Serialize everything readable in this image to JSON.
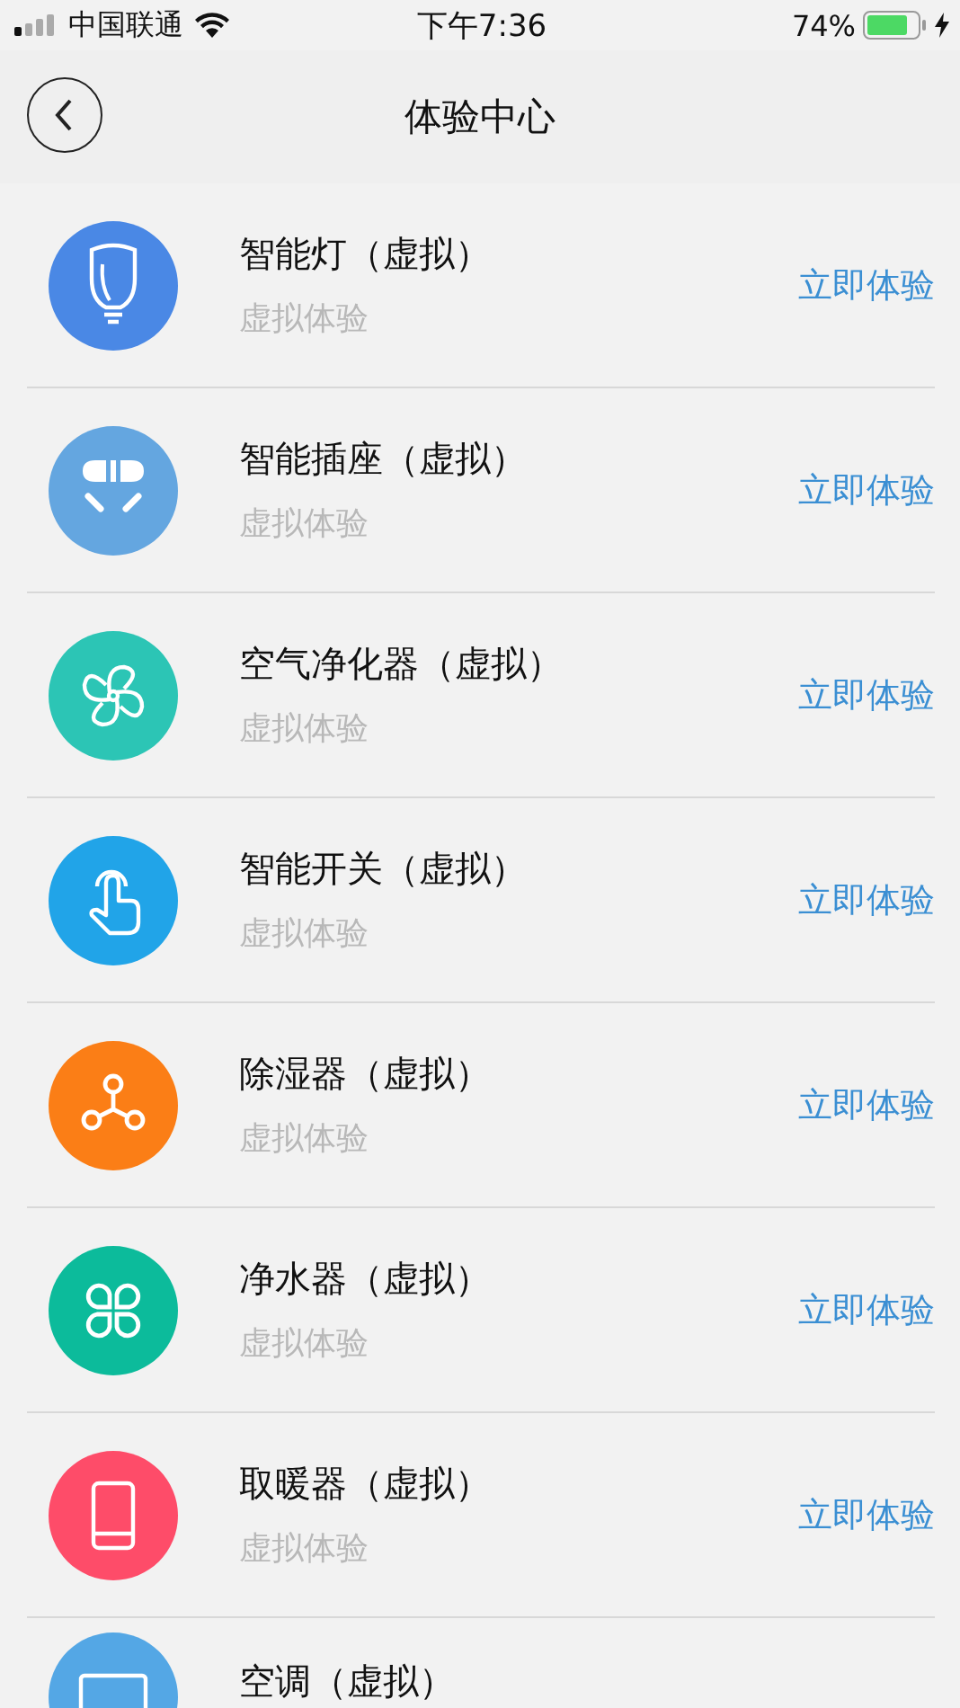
{
  "status_bar": {
    "carrier": "中国联通",
    "time": "下午7:36",
    "battery": "74%"
  },
  "nav": {
    "title": "体验中心"
  },
  "devices": [
    {
      "name": "智能灯（虚拟）",
      "subtitle": "虚拟体验",
      "action": "立即体验",
      "kind": "bulb",
      "color": "#4a88e5"
    },
    {
      "name": "智能插座（虚拟）",
      "subtitle": "虚拟体验",
      "action": "立即体验",
      "kind": "socket",
      "color": "#64a6e0"
    },
    {
      "name": "空气净化器（虚拟）",
      "subtitle": "虚拟体验",
      "action": "立即体验",
      "kind": "fan",
      "color": "#2cc5b5"
    },
    {
      "name": "智能开关（虚拟）",
      "subtitle": "虚拟体验",
      "action": "立即体验",
      "kind": "touch",
      "color": "#21a4e8"
    },
    {
      "name": "除湿器（虚拟）",
      "subtitle": "虚拟体验",
      "action": "立即体验",
      "kind": "nodes",
      "color": "#fb7e16"
    },
    {
      "name": "净水器（虚拟）",
      "subtitle": "虚拟体验",
      "action": "立即体验",
      "kind": "clover",
      "color": "#0cbb9b"
    },
    {
      "name": "取暖器（虚拟）",
      "subtitle": "虚拟体验",
      "action": "立即体验",
      "kind": "heater",
      "color": "#fe4c69"
    },
    {
      "name": "空调（虚拟）",
      "kind": "ac",
      "color": "#54a7e5"
    }
  ]
}
